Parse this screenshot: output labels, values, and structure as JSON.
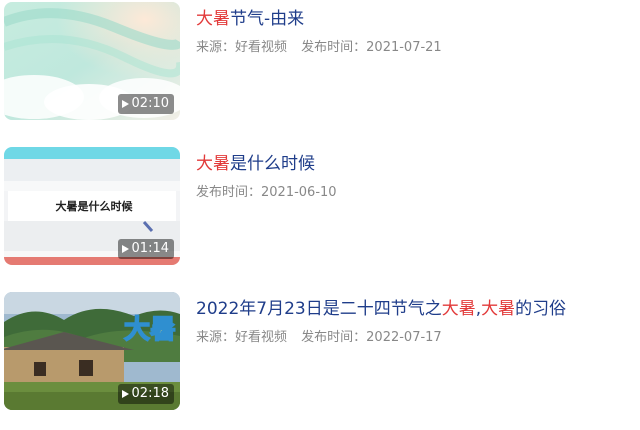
{
  "results": [
    {
      "title_parts": [
        {
          "text": "大暑",
          "hl": true
        },
        {
          "text": "节气-由来",
          "hl": false
        }
      ],
      "source": "来源：好看视频",
      "date": "发布时间：2021-07-21",
      "duration": "02:10"
    },
    {
      "title_parts": [
        {
          "text": "大暑",
          "hl": true
        },
        {
          "text": "是什么时候",
          "hl": false
        }
      ],
      "date": "发布时间：2021-06-10",
      "duration": "01:14",
      "thumb_text": "大暑是什么时候"
    },
    {
      "title_parts": [
        {
          "text": "2022年7月23日是二十四节气之",
          "hl": false
        },
        {
          "text": "大暑",
          "hl": true
        },
        {
          "text": ",",
          "hl": false
        },
        {
          "text": "大暑",
          "hl": true
        },
        {
          "text": "的习俗",
          "hl": false
        }
      ],
      "source": "来源：好看视频",
      "date": "发布时间：2022-07-17",
      "duration": "02:18",
      "thumb_text": "大暑"
    }
  ],
  "colors": {
    "title": "#1f3d8a",
    "highlight": "#e23a3a",
    "meta": "#888888"
  }
}
